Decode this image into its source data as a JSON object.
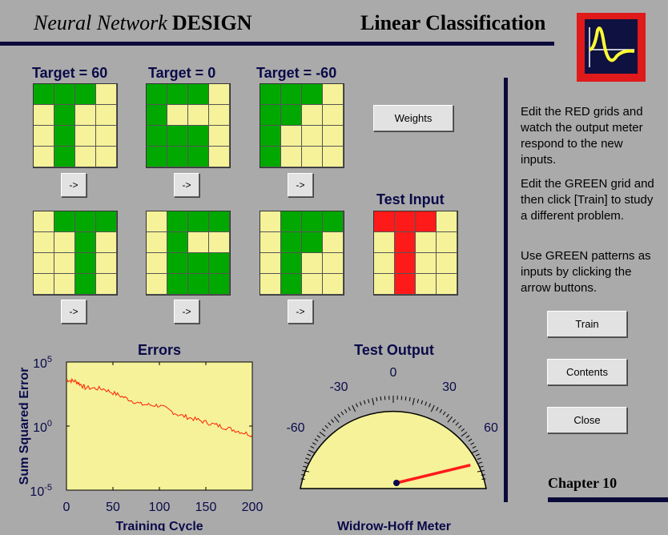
{
  "header": {
    "title_italic": "Neural Network",
    "title_bold": "DESIGN",
    "subtitle": "Linear Classification",
    "logo_icon": "sine-wave-logo-icon"
  },
  "colors": {
    "green": "#00a800",
    "yellow": "#f5f29a",
    "red": "#ff1a1a",
    "navy": "#0a0a3a"
  },
  "patterns": [
    {
      "label": "Target = 60",
      "grid": [
        [
          "G",
          "G",
          "G",
          "Y"
        ],
        [
          "Y",
          "G",
          "Y",
          "Y"
        ],
        [
          "Y",
          "G",
          "Y",
          "Y"
        ],
        [
          "Y",
          "G",
          "Y",
          "Y"
        ]
      ]
    },
    {
      "label": "Target = 0",
      "grid": [
        [
          "G",
          "G",
          "G",
          "Y"
        ],
        [
          "G",
          "Y",
          "Y",
          "Y"
        ],
        [
          "G",
          "G",
          "G",
          "Y"
        ],
        [
          "G",
          "G",
          "G",
          "Y"
        ]
      ]
    },
    {
      "label": "Target = -60",
      "grid": [
        [
          "G",
          "G",
          "G",
          "Y"
        ],
        [
          "G",
          "G",
          "Y",
          "Y"
        ],
        [
          "G",
          "Y",
          "Y",
          "Y"
        ],
        [
          "G",
          "Y",
          "Y",
          "Y"
        ]
      ]
    },
    {
      "label": "",
      "grid": [
        [
          "Y",
          "G",
          "G",
          "G"
        ],
        [
          "Y",
          "Y",
          "G",
          "Y"
        ],
        [
          "Y",
          "Y",
          "G",
          "Y"
        ],
        [
          "Y",
          "Y",
          "G",
          "Y"
        ]
      ]
    },
    {
      "label": "",
      "grid": [
        [
          "Y",
          "G",
          "G",
          "G"
        ],
        [
          "Y",
          "G",
          "Y",
          "Y"
        ],
        [
          "Y",
          "G",
          "G",
          "G"
        ],
        [
          "Y",
          "G",
          "G",
          "G"
        ]
      ]
    },
    {
      "label": "",
      "grid": [
        [
          "Y",
          "G",
          "G",
          "G"
        ],
        [
          "Y",
          "G",
          "G",
          "Y"
        ],
        [
          "Y",
          "G",
          "Y",
          "Y"
        ],
        [
          "Y",
          "G",
          "Y",
          "Y"
        ]
      ]
    }
  ],
  "arrow_label": "->",
  "weights_button": "Weights",
  "test_input": {
    "label": "Test Input",
    "grid": [
      [
        "R",
        "R",
        "R",
        "Y"
      ],
      [
        "Y",
        "R",
        "Y",
        "Y"
      ],
      [
        "Y",
        "R",
        "Y",
        "Y"
      ],
      [
        "Y",
        "R",
        "Y",
        "Y"
      ]
    ]
  },
  "sidebar": {
    "p1": "Edit the RED grids and watch the output meter respond to the new inputs.",
    "p2": "Edit the GREEN grid and then click [Train] to study a different problem.",
    "p3": "Use GREEN patterns as inputs by clicking the arrow buttons.",
    "train": "Train",
    "contents": "Contents",
    "close": "Close",
    "chapter": "Chapter 10"
  },
  "errors_chart": {
    "title": "Errors",
    "ylabel": "Sum Squared Error",
    "xlabel": "Training Cycle",
    "x_ticks": [
      "0",
      "50",
      "100",
      "150",
      "200"
    ],
    "y_ticks": [
      {
        "base": "10",
        "exp": "5"
      },
      {
        "base": "10",
        "exp": "0"
      },
      {
        "base": "10",
        "exp": "-5"
      }
    ]
  },
  "chart_data": {
    "type": "line",
    "title": "Errors",
    "xlabel": "Training Cycle",
    "ylabel": "Sum Squared Error",
    "xlim": [
      0,
      200
    ],
    "ylim_log10": [
      -5,
      5
    ],
    "y_scale": "log",
    "series": [
      {
        "x": [
          0,
          10,
          20,
          40,
          60,
          80,
          100,
          120,
          140,
          160,
          180,
          200
        ],
        "log10_y": [
          3.6,
          3.5,
          3.0,
          2.9,
          2.3,
          1.7,
          1.6,
          0.9,
          0.5,
          0.1,
          -0.3,
          -0.7
        ]
      }
    ]
  },
  "meter": {
    "title": "Test Output",
    "subtitle": "Widrow-Hoff Meter",
    "labels": [
      "-60",
      "-30",
      "0",
      "30",
      "60"
    ],
    "value": 54
  }
}
